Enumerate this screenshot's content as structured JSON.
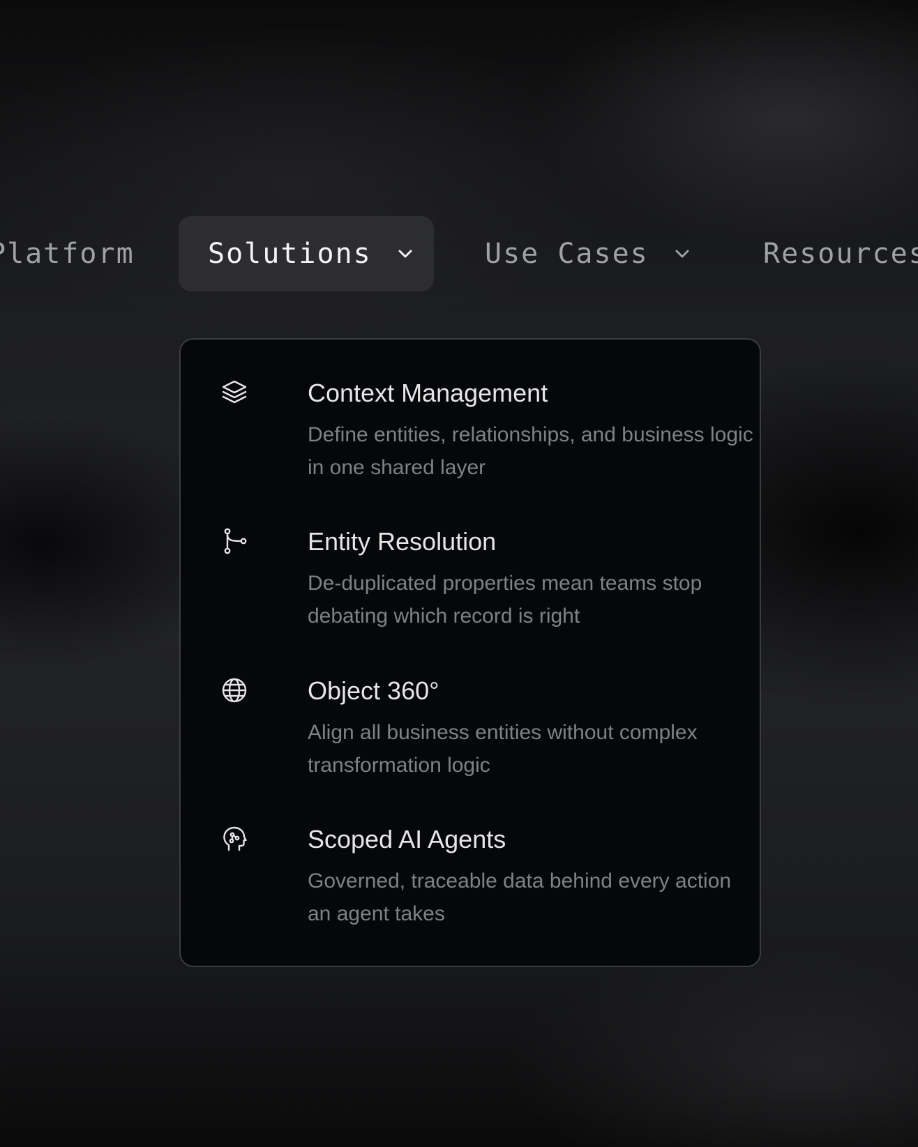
{
  "nav": {
    "items": [
      {
        "label": "Platform"
      },
      {
        "label": "Solutions"
      },
      {
        "label": "Use Cases"
      },
      {
        "label": "Resources"
      }
    ]
  },
  "menu": {
    "items": [
      {
        "icon": "layers-icon",
        "title": "Context Management",
        "description": "Define entities, relationships, and business logic in one shared layer"
      },
      {
        "icon": "git-branch-icon",
        "title": "Entity Resolution",
        "description": "De-duplicated properties mean teams stop debating which record is right"
      },
      {
        "icon": "globe-icon",
        "title": "Object 360°",
        "description": "Align all business entities without complex transformation logic"
      },
      {
        "icon": "ai-brain-head-icon",
        "title": "Scoped AI Agents",
        "description": "Governed, traceable data behind every action an agent takes"
      }
    ]
  },
  "colors": {
    "menu_background": "#060708",
    "menu_border": "#3b3c3f",
    "title_text": "#e6e6e8",
    "description_text": "#7f8186",
    "nav_text": "#9fa1a5",
    "nav_active_text": "#f4f4f5"
  }
}
